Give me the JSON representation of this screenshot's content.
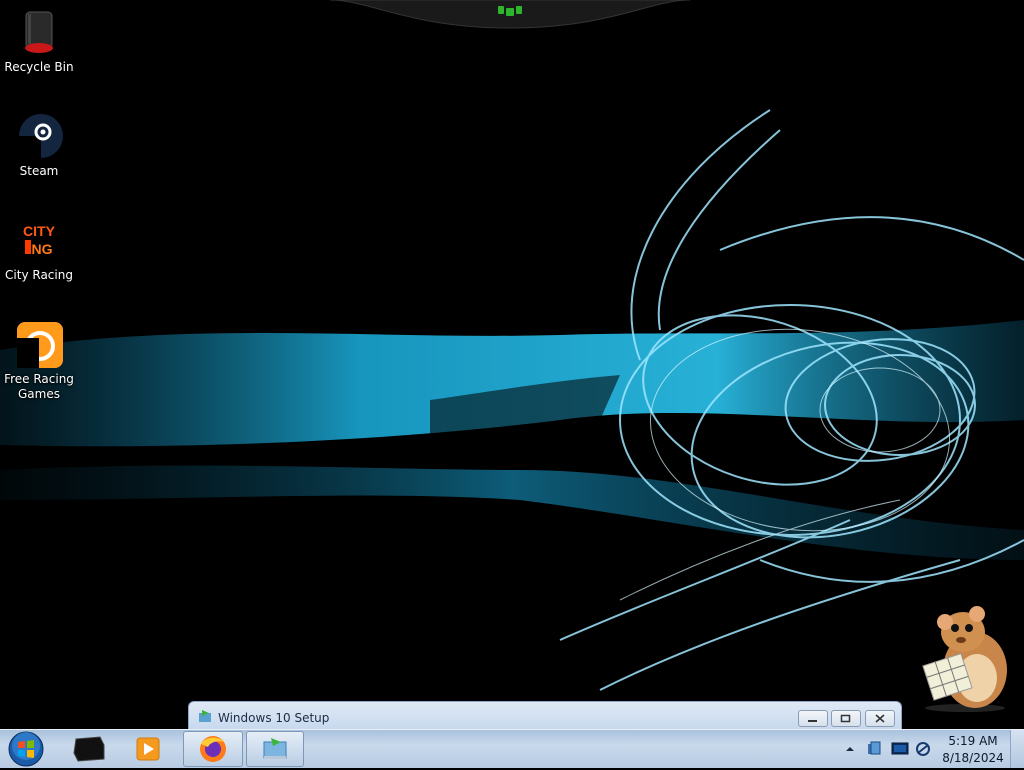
{
  "desktop": {
    "icons": [
      {
        "label": "Recycle Bin",
        "icon": "recycle-bin-icon"
      },
      {
        "label": "Steam",
        "icon": "steam-icon"
      },
      {
        "label": "City Racing",
        "icon": "city-racing-icon",
        "logo_text": "CITY RACING"
      },
      {
        "label": "Free Racing Games",
        "icon": "free-racing-games-icon"
      }
    ]
  },
  "window": {
    "title": "Windows 10 Setup",
    "controls": [
      "minimize",
      "restore",
      "close"
    ]
  },
  "taskbar": {
    "pinned": [
      "start-orb-icon",
      "black-box-icon",
      "media-player-icon",
      "firefox-icon",
      "setup-app-icon"
    ],
    "tray": [
      "show-hidden-icons-arrow",
      "network-drive-icon",
      "monitor-icon",
      "network-icon"
    ],
    "clock": {
      "time": "5:19 AM",
      "date": "8/18/2024"
    }
  },
  "colors": {
    "taskbar_bg": "#c9d9ec",
    "wallpaper_accent": "#2cb7e0",
    "gadget_green": "#2db52d"
  }
}
